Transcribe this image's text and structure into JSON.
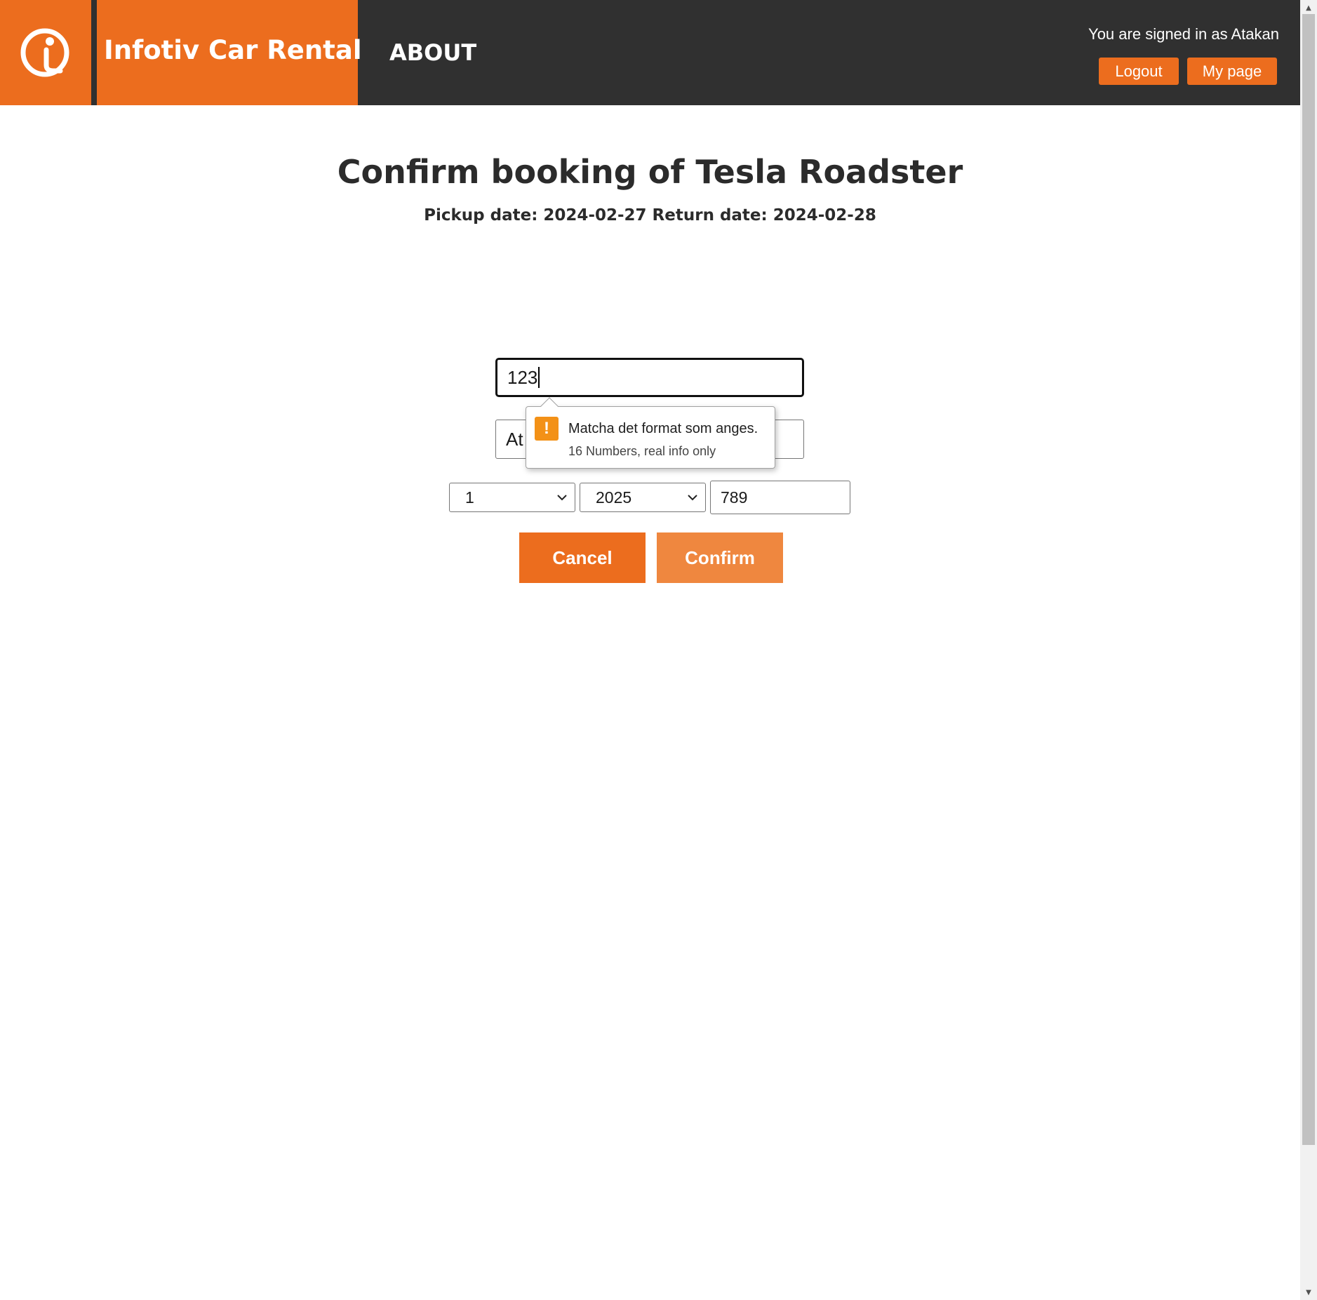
{
  "header": {
    "brand": "Infotiv Car Rental",
    "nav_about": "ABOUT",
    "signed_in_text": "You are signed in as Atakan",
    "logout_label": "Logout",
    "my_page_label": "My page",
    "logo_icon": "info-i-logo-icon",
    "brand_color": "#ec6d1e",
    "background_color": "#303030"
  },
  "booking": {
    "title": "Confirm booking of Tesla Roadster",
    "dates": "Pickup date: 2024-02-27 Return date: 2024-02-28",
    "card_number_value": "123",
    "card_name_value": "At",
    "exp_month_value": "1",
    "exp_year_value": "2025",
    "cvc_value": "789",
    "cancel_label": "Cancel",
    "confirm_label": "Confirm"
  },
  "validation": {
    "message": "Matcha det format som anges.",
    "hint": "16 Numbers, real info only",
    "icon": "warning-exclamation-icon",
    "icon_color": "#f39117"
  }
}
